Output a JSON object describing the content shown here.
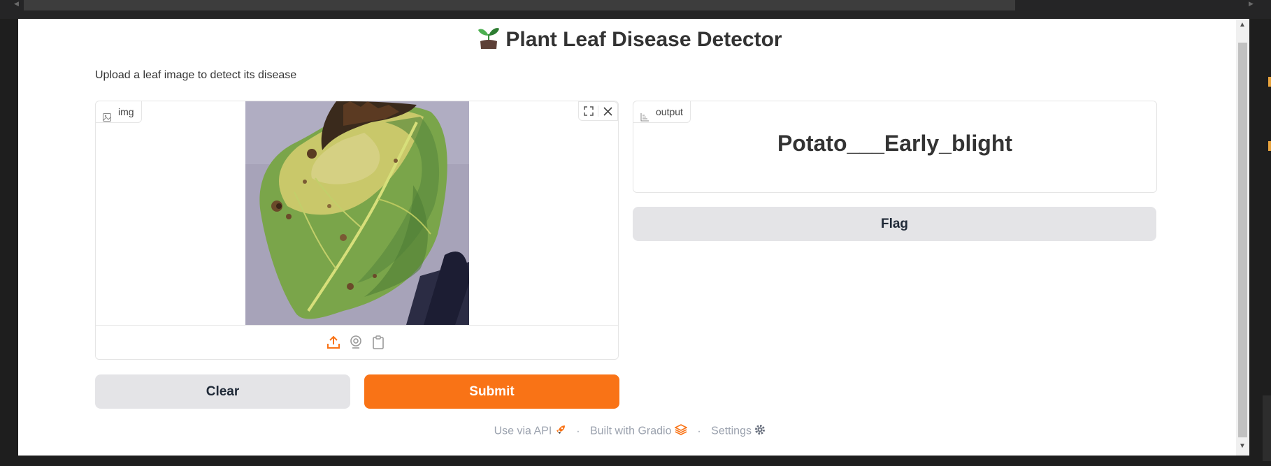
{
  "app": {
    "title": "Plant Leaf Disease Detector",
    "title_emoji": "🌱",
    "description": "Upload a leaf image to detect its disease"
  },
  "input_panel": {
    "label": "img",
    "label_icon": "image-icon",
    "image_alt": "leaf photo",
    "tools": [
      "fullscreen-icon",
      "close-icon"
    ],
    "sources": [
      "upload-icon",
      "webcam-icon",
      "clipboard-icon"
    ]
  },
  "output_panel": {
    "label": "output",
    "label_icon": "chart-icon",
    "value": "Potato___Early_blight"
  },
  "buttons": {
    "clear": "Clear",
    "submit": "Submit",
    "flag": "Flag"
  },
  "footer": {
    "api": "Use via API",
    "built": "Built with Gradio",
    "settings": "Settings",
    "separator": "·"
  },
  "colors": {
    "accent": "#f97316",
    "secondary_button": "#e4e4e7",
    "window_bg": "#1e1e1e"
  }
}
